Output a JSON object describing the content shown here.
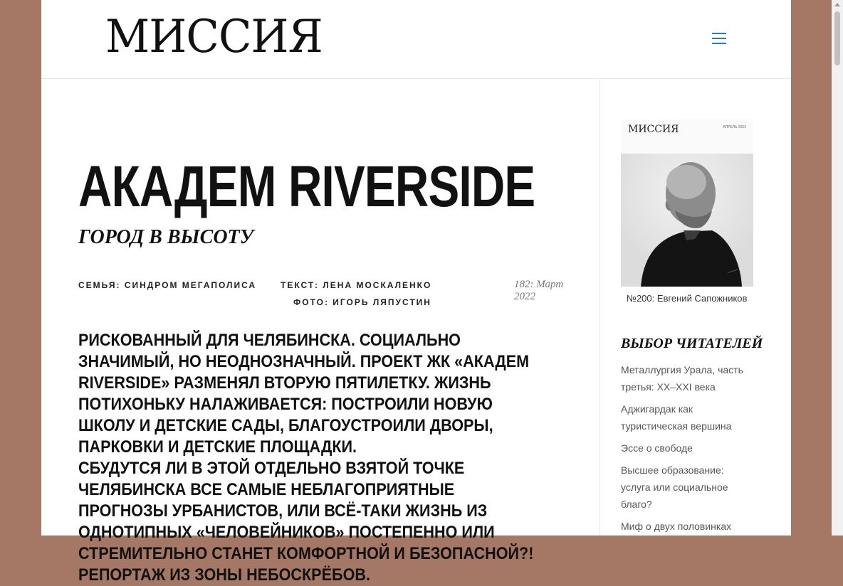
{
  "header": {
    "logo": "МИССИЯ"
  },
  "article": {
    "title": "АКАДЕМ RIVERSIDE",
    "subtitle": "ГОРОД В ВЫСОТУ",
    "section": "СЕМЬЯ: СИНДРОМ МЕГАПОЛИСА",
    "text_credit": "ТЕКСТ: ЛЕНА МОСКАЛЕНКО",
    "photo_credit": "ФОТО: ИГОРЬ ЛЯПУСТИН",
    "issue": "182: Март 2022",
    "lead_1": "Рискованный для Челябинска. Социально значимый, но неоднозначный. Проект ЖК «Академ Riverside» разменял вторую пятилетку. Жизнь потихоньку налаживается: построили новую школу и детские сады, благоустроили дворы, парковки и детские площадки.",
    "lead_2": "Сбудутся ли в этой отдельно взятой точке Челябинска все самые неблагоприятные прогнозы урбанистов, или всё-таки жизнь из однотипных «человейников» постепенно или стремительно станет комфортной и безопасной?! Репортаж из зоны небоскрёбов."
  },
  "sidebar": {
    "cover_logo": "МИССИЯ",
    "cover_date": "АПРЕЛЬ 2023",
    "cover_caption": "№200: Евгений Сапожников",
    "reader_title": "ВЫБОР ЧИТАТЕЛЕЙ",
    "reader_items": [
      "Металлургия Урала, часть третья: XX–XXI века",
      "Аджигардак как туристическая вершина",
      "Эссе о свободе",
      "Высшее образование: услуга или социальное благо?",
      "Миф о двух половинках"
    ]
  }
}
